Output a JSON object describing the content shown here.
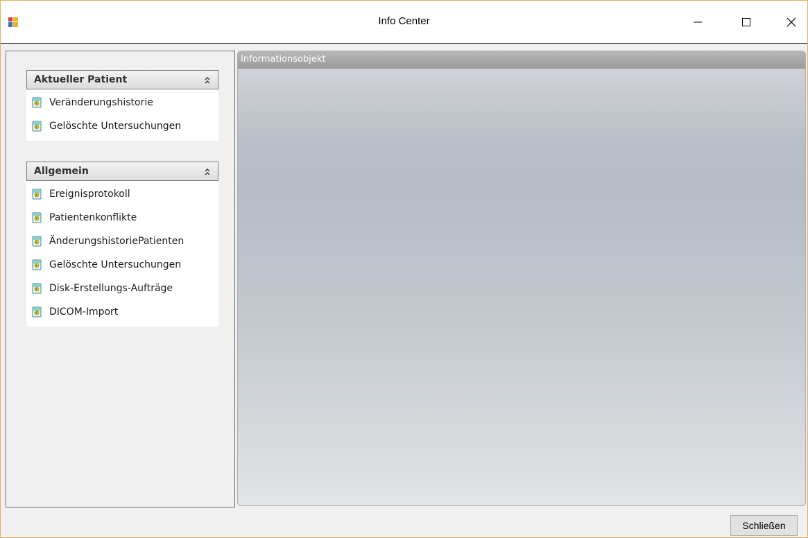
{
  "window": {
    "title": "Info Center",
    "minimize_icon": "minimize-icon",
    "maximize_icon": "maximize-icon",
    "close_icon": "close-icon"
  },
  "left_panel": {
    "groups": [
      {
        "header": "Aktueller Patient",
        "collapse_icon": "chevron-double-up-icon",
        "items": [
          {
            "label": "Veränderungshistorie",
            "icon": "document-icon"
          },
          {
            "label": "Gelöschte Untersuchungen",
            "icon": "document-icon"
          }
        ]
      },
      {
        "header": "Allgemein",
        "collapse_icon": "chevron-double-up-icon",
        "items": [
          {
            "label": "Ereignisprotokoll",
            "icon": "document-icon"
          },
          {
            "label": "Patientenkonflikte",
            "icon": "document-icon"
          },
          {
            "label": "ÄnderungshistoriePatienten",
            "icon": "document-icon"
          },
          {
            "label": "Gelöschte Untersuchungen",
            "icon": "document-icon"
          },
          {
            "label": "Disk-Erstellungs-Aufträge",
            "icon": "document-icon"
          },
          {
            "label": "DICOM-Import",
            "icon": "document-icon"
          }
        ]
      }
    ]
  },
  "right_panel": {
    "header": "Informationsobjekt"
  },
  "footer": {
    "close_button": "Schließen"
  },
  "colors": {
    "title_border": "#e0b060",
    "panel_header_gray": "#a8a8a8",
    "icon_teal": "#2a9a9a",
    "icon_yellow": "#f0c020"
  }
}
